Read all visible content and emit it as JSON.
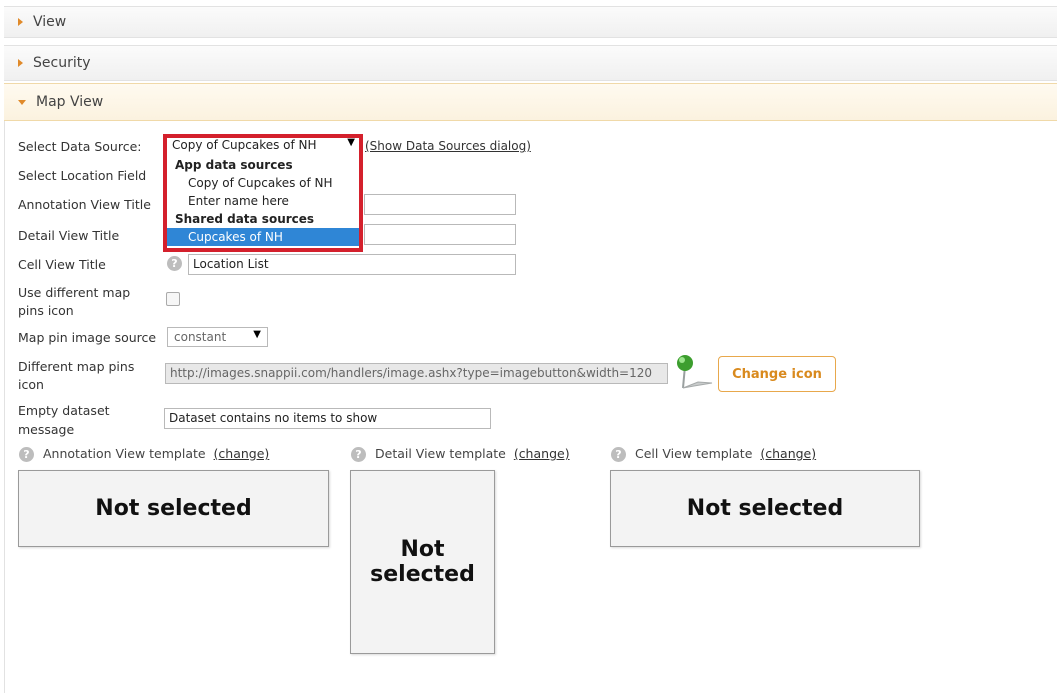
{
  "panels": [
    {
      "label": "View"
    },
    {
      "label": "Security"
    },
    {
      "label": "Map View"
    }
  ],
  "form": {
    "data_source": {
      "label": "Select Data Source:",
      "value": "Copy of Cupcakes of NH",
      "dialog_link": "(Show Data Sources dialog)"
    },
    "location_field": {
      "label": "Select Location Field"
    },
    "annotation_title": {
      "label": "Annotation View Title",
      "value": ""
    },
    "detail_title": {
      "label": "Detail View Title",
      "value": ""
    },
    "cell_title": {
      "label": "Cell View Title",
      "value": "Location List"
    },
    "different_pins": {
      "label_1": "Use different map",
      "label_2": "pins icon"
    },
    "pin_source": {
      "label": "Map pin image source",
      "value": "constant"
    },
    "pins_icon": {
      "label_1": "Different map pins",
      "label_2": "icon",
      "value": "http://images.snappii.com/handlers/image.ashx?type=imagebutton&width=120",
      "button": "Change icon"
    },
    "empty_message": {
      "label_1": "Empty dataset",
      "label_2": "message",
      "value": "Dataset contains no items to show"
    }
  },
  "dropdown": {
    "groups": [
      {
        "label": "App data sources",
        "items": [
          "Copy of Cupcakes of NH",
          "Enter name here"
        ]
      },
      {
        "label": "Shared data sources",
        "items": [
          "Cupcakes of NH"
        ]
      }
    ],
    "selected": "Cupcakes of NH"
  },
  "templates": [
    {
      "label": "Annotation View template",
      "change": "(change)",
      "content": "Not selected"
    },
    {
      "label": "Detail View template",
      "change": "(change)",
      "content_1": "Not",
      "content_2": "selected"
    },
    {
      "label": "Cell View template",
      "change": "(change)",
      "content": "Not selected"
    }
  ],
  "help_glyph": "?",
  "colors": {
    "accent": "#e08a2a",
    "highlight": "#d4202c",
    "selection": "#2f86d6"
  }
}
